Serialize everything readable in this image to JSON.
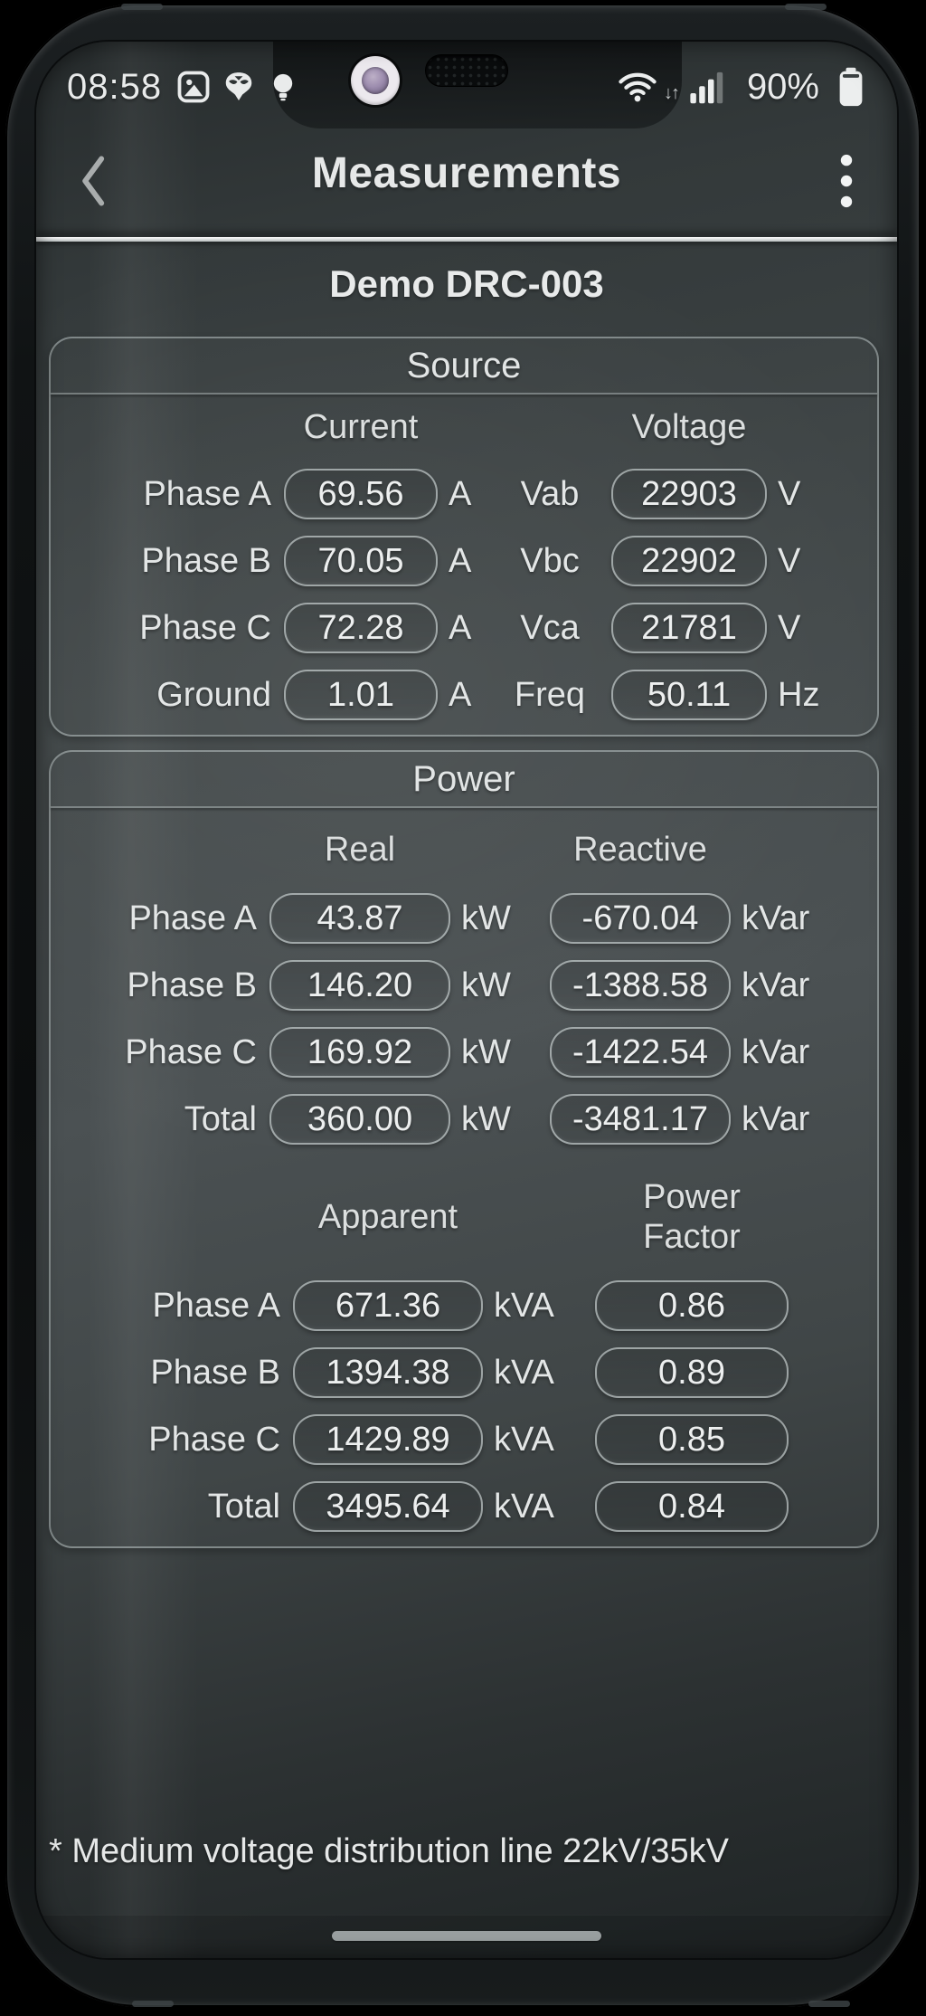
{
  "status_bar": {
    "time": "08:58",
    "battery_percent": "90%",
    "left_icons": [
      "gallery-icon",
      "alien-icon",
      "lightbulb-icon"
    ],
    "right_icons": [
      "wifi-icon",
      "signal-strength-icon",
      "battery-icon"
    ]
  },
  "header": {
    "title": "Measurements"
  },
  "device": {
    "title": "Demo DRC-003"
  },
  "source": {
    "title": "Source",
    "columns": {
      "current": "Current",
      "voltage": "Voltage"
    },
    "rows": [
      {
        "label": "Phase A",
        "current": "69.56",
        "current_unit": "A",
        "vlabel": "Vab",
        "voltage": "22903",
        "voltage_unit": "V"
      },
      {
        "label": "Phase B",
        "current": "70.05",
        "current_unit": "A",
        "vlabel": "Vbc",
        "voltage": "22902",
        "voltage_unit": "V"
      },
      {
        "label": "Phase C",
        "current": "72.28",
        "current_unit": "A",
        "vlabel": "Vca",
        "voltage": "21781",
        "voltage_unit": "V"
      },
      {
        "label": "Ground",
        "current": "1.01",
        "current_unit": "A",
        "vlabel": "Freq",
        "voltage": "50.11",
        "voltage_unit": "Hz"
      }
    ]
  },
  "power": {
    "title": "Power",
    "real_reactive": {
      "columns": {
        "real": "Real",
        "reactive": "Reactive"
      },
      "rows": [
        {
          "label": "Phase A",
          "real": "43.87",
          "real_unit": "kW",
          "reactive": "-670.04",
          "reactive_unit": "kVar"
        },
        {
          "label": "Phase B",
          "real": "146.20",
          "real_unit": "kW",
          "reactive": "-1388.58",
          "reactive_unit": "kVar"
        },
        {
          "label": "Phase C",
          "real": "169.92",
          "real_unit": "kW",
          "reactive": "-1422.54",
          "reactive_unit": "kVar"
        },
        {
          "label": "Total",
          "real": "360.00",
          "real_unit": "kW",
          "reactive": "-3481.17",
          "reactive_unit": "kVar"
        }
      ]
    },
    "apparent_pf": {
      "columns": {
        "apparent": "Apparent",
        "power_factor": "Power Factor"
      },
      "rows": [
        {
          "label": "Phase A",
          "apparent": "671.36",
          "apparent_unit": "kVA",
          "power_factor": "0.86"
        },
        {
          "label": "Phase B",
          "apparent": "1394.38",
          "apparent_unit": "kVA",
          "power_factor": "0.89"
        },
        {
          "label": "Phase C",
          "apparent": "1429.89",
          "apparent_unit": "kVA",
          "power_factor": "0.85"
        },
        {
          "label": "Total",
          "apparent": "3495.64",
          "apparent_unit": "kVA",
          "power_factor": "0.84"
        }
      ]
    }
  },
  "footer": {
    "note": "* Medium voltage distribution line 22kV/35kV"
  },
  "colors": {
    "screen_bg": "#424849",
    "text": "#e9ebeb",
    "camera_lens": "#9c8cae",
    "home_pill": "#9aa0a1"
  }
}
